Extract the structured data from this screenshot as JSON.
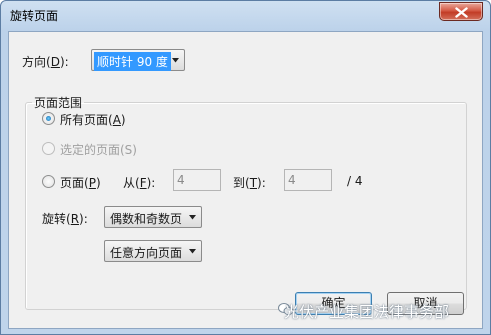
{
  "window": {
    "title": "旋转页面"
  },
  "direction": {
    "label_prefix": "方向(",
    "label_key": "D",
    "label_suffix": "):",
    "selected": "顺时针 90 度"
  },
  "page_range": {
    "group_title": "页面范围",
    "all_pages": {
      "prefix": "所有页面(",
      "key": "A",
      "suffix": ")",
      "checked": true
    },
    "selected_pages": {
      "label": "选定的页面(S)",
      "enabled": false
    },
    "pages": {
      "prefix": "页面(",
      "key": "P",
      "suffix": ")",
      "from_prefix": "从(",
      "from_key": "F",
      "from_suffix": "):",
      "from_value": "4",
      "to_prefix": "到(",
      "to_key": "T",
      "to_suffix": "):",
      "to_value": "4",
      "total": "/ 4"
    },
    "rotate": {
      "prefix": "旋转(",
      "key": "R",
      "suffix": "):",
      "parity_selected": "偶数和奇数页",
      "orientation_selected": "任意方向页面"
    }
  },
  "buttons": {
    "ok": "确定",
    "cancel": "取消"
  },
  "watermark": {
    "text": "光伏产业集团法律事务部"
  }
}
